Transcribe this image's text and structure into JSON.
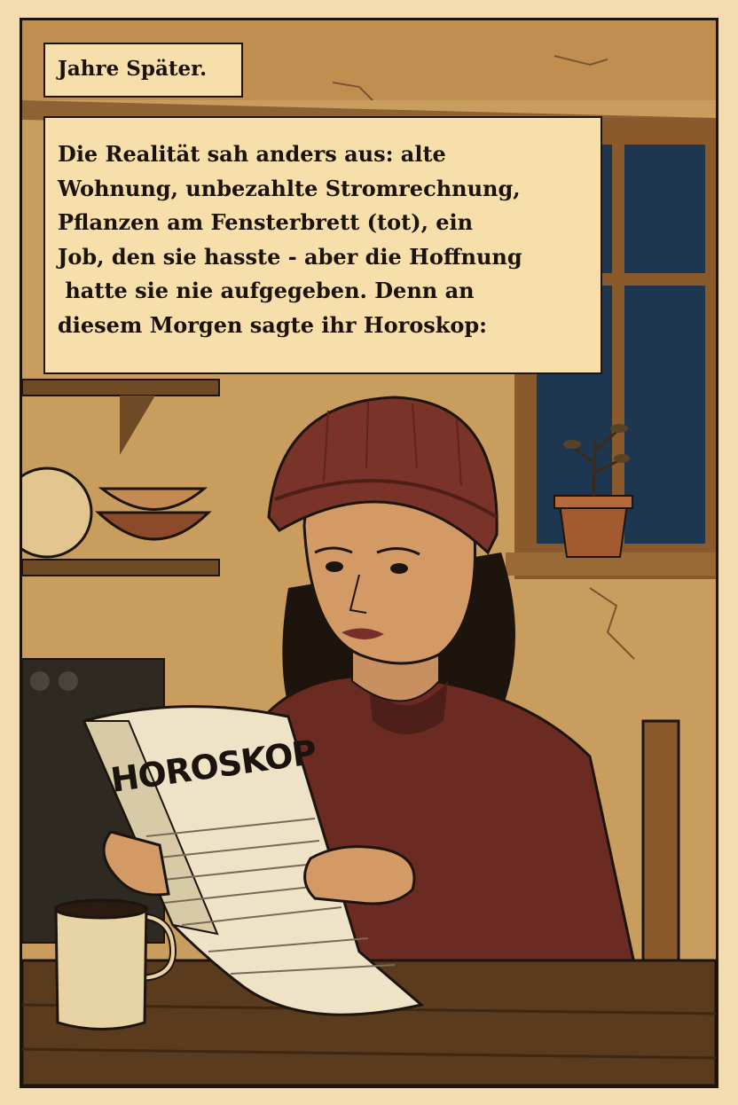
{
  "captions": {
    "time_jump": "Jahre Später.",
    "narration_lines": [
      "Die Realität sah anders aus: alte",
      "Wohnung, unbezahlte Stromrechnung,",
      "Pflanzen am Fensterbrett (tot), ein",
      "Job, den sie hasste - aber die Hoffnung",
      " hatte sie nie aufgegeben. Denn an",
      "diesem Morgen sagte ihr Horoskop:"
    ]
  },
  "newspaper": {
    "headline": "HOROSKOP"
  },
  "colors": {
    "background": "#f3ddb0",
    "caption_fill": "#f6dfaa",
    "wall": "#c79b5c",
    "night_sky": "#1f3a52",
    "beanie": "#7a3328",
    "jacket": "#6b2a22",
    "ink": "#1c140d"
  }
}
